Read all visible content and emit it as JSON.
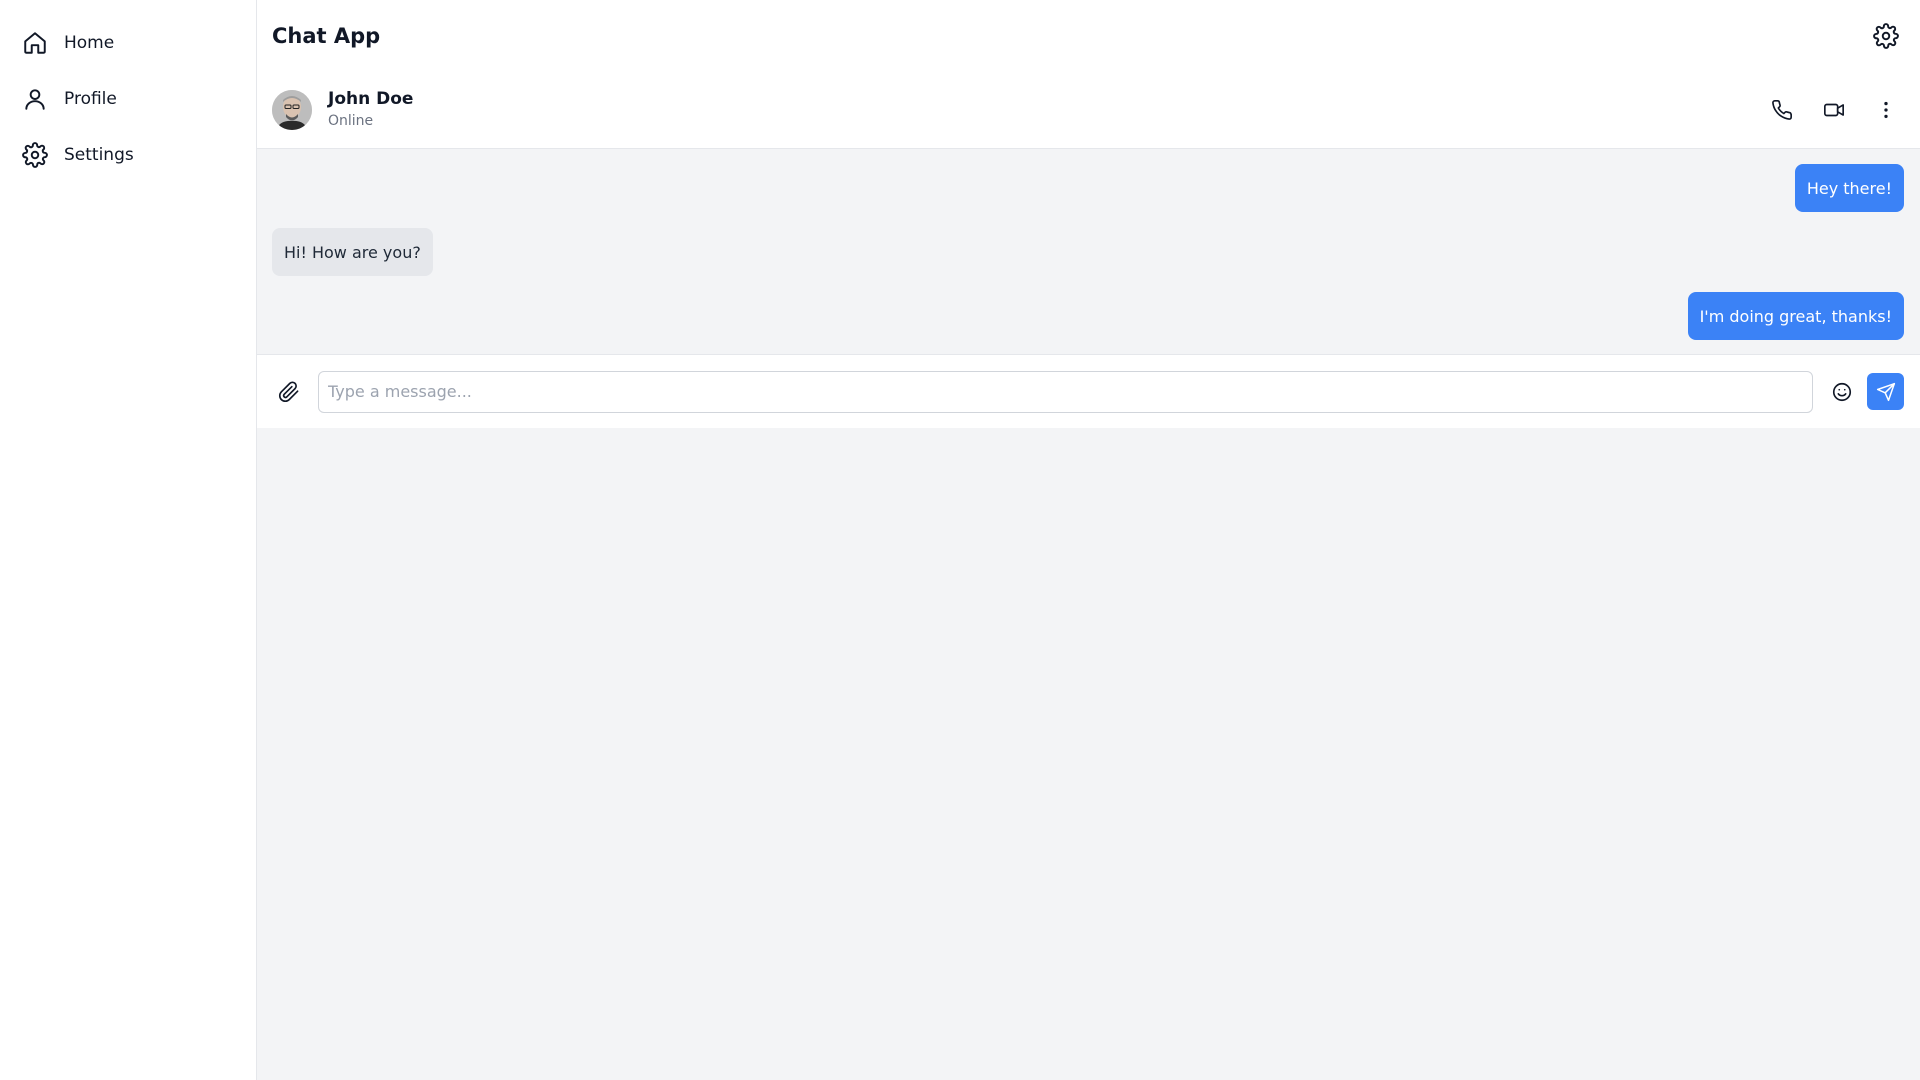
{
  "sidebar": {
    "items": [
      {
        "label": "Home",
        "icon": "home-icon"
      },
      {
        "label": "Profile",
        "icon": "user-icon"
      },
      {
        "label": "Settings",
        "icon": "gear-icon"
      }
    ]
  },
  "header": {
    "title": "Chat App",
    "settings_icon": "gear-icon"
  },
  "chat": {
    "contact": {
      "name": "John Doe",
      "status": "Online",
      "avatar": "avatar-photo"
    },
    "actions": [
      {
        "icon": "phone-icon"
      },
      {
        "icon": "video-icon"
      },
      {
        "icon": "more-vertical-icon"
      }
    ],
    "messages": [
      {
        "text": "Hey there!",
        "direction": "sent"
      },
      {
        "text": "Hi! How are you?",
        "direction": "received"
      },
      {
        "text": "I'm doing great, thanks!",
        "direction": "sent"
      }
    ]
  },
  "composer": {
    "placeholder": "Type a message...",
    "value": "",
    "attach_icon": "paperclip-icon",
    "emoji_icon": "smile-icon",
    "send_icon": "send-icon"
  },
  "colors": {
    "accent": "#3b82f6",
    "sent_text": "#ffffff",
    "received_bg": "#e5e7eb",
    "chat_bg": "#f3f4f6"
  }
}
